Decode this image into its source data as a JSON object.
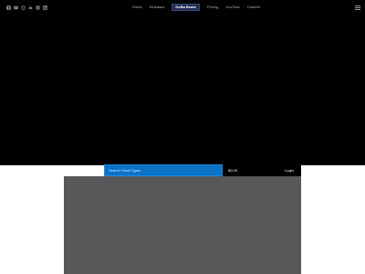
{
  "header": {
    "social_icons": [
      "facebook-icon",
      "youtube-icon",
      "instagram-icon",
      "soundcloud-icon",
      "pinterest-icon",
      "linkedin-icon"
    ],
    "nav": [
      "Home",
      "Releases",
      "DoBa Beats",
      "Pricing",
      "YouTube",
      "Careers"
    ],
    "active_nav": "DoBa Beats",
    "menu_icon": "menu-icon"
  },
  "search": {
    "placeholder": "Search Track Types",
    "price": "$0.00",
    "login": "Login"
  },
  "colors": {
    "hero_background": "#000000",
    "search_blue": "#0b72c6",
    "content_gray": "#58585b"
  }
}
